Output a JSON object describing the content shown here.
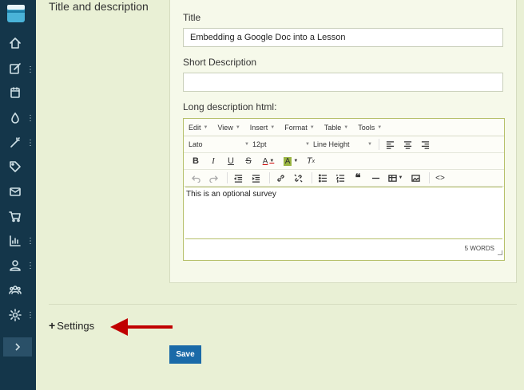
{
  "section": {
    "title": "Title and description"
  },
  "form": {
    "title_label": "Title",
    "title_value": "Embedding a Google Doc into a Lesson",
    "short_description_label": "Short Description",
    "short_description_value": "",
    "long_description_label": "Long description html:"
  },
  "editor": {
    "menus": [
      "Edit",
      "View",
      "Insert",
      "Format",
      "Table",
      "Tools"
    ],
    "font_family": "Lato",
    "font_size": "12pt",
    "line_height": "Line Height",
    "content": "This is an optional survey",
    "word_count": "5 WORDS"
  },
  "settings": {
    "label": "Settings",
    "plus": "+"
  },
  "actions": {
    "save_label": "Save"
  },
  "colors": {
    "sidebar": "#14364a",
    "page_bg": "#e9f0d5",
    "save": "#1a6aa8",
    "arrow": "#c00000"
  }
}
